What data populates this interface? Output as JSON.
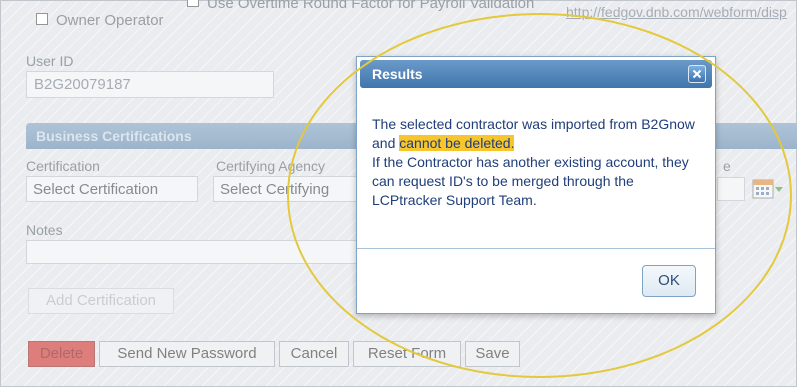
{
  "form": {
    "owner_operator_label": "Owner Operator",
    "overtime_label": "Use Overtime Round Factor for Payroll Validation",
    "link_text": "http://fedgov.dnb.com/webform/disp",
    "user_id_label": "User ID",
    "user_id_value": "B2G20079187",
    "section_title": "Business Certifications",
    "certification_label": "Certification",
    "certification_value": "Select Certification",
    "agency_label": "Certifying Agency",
    "agency_value": "Select Certifying",
    "date_label_fragment": "e",
    "notes_label": "Notes",
    "add_certification": "Add Certification"
  },
  "buttons": {
    "delete": "Delete",
    "send_password": "Send New Password",
    "cancel": "Cancel",
    "reset_form": "Reset Form",
    "save": "Save"
  },
  "dialog": {
    "title": "Results",
    "msg_part1": "The selected contractor was imported from B2Gnow and ",
    "msg_highlight": "cannot be deleted.",
    "msg_part2": "If the Contractor has another existing account, they can request ID's to be merged through the LCPtracker Support Team.",
    "ok": "OK"
  },
  "colors": {
    "highlight": "#f7c52e",
    "annotation_ellipse": "#e3c93b",
    "dialog_header": "#3f76ad",
    "delete_button": "#c9302c"
  },
  "icons": {
    "calendar": "calendar-icon",
    "close": "close-icon"
  }
}
